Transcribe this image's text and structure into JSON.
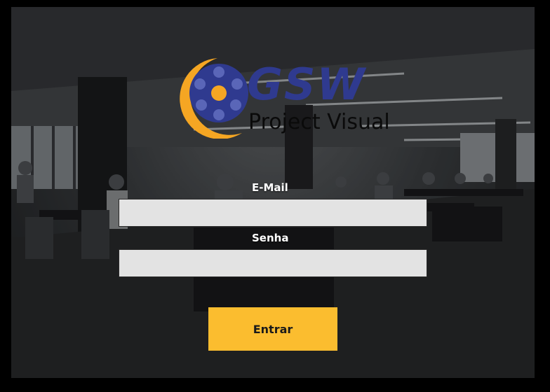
{
  "logo": {
    "title": "GSW",
    "subtitle": "Project Visual",
    "colors": {
      "primary": "#2f3a8f",
      "accent": "#f5a623"
    }
  },
  "form": {
    "email_label": "E-Mail",
    "email_value": "",
    "password_label": "Senha",
    "password_value": "",
    "submit_label": "Entrar"
  },
  "colors": {
    "button": "#fbbd2f",
    "field_background": "#e3e3e3",
    "label_text": "#ffffff"
  }
}
